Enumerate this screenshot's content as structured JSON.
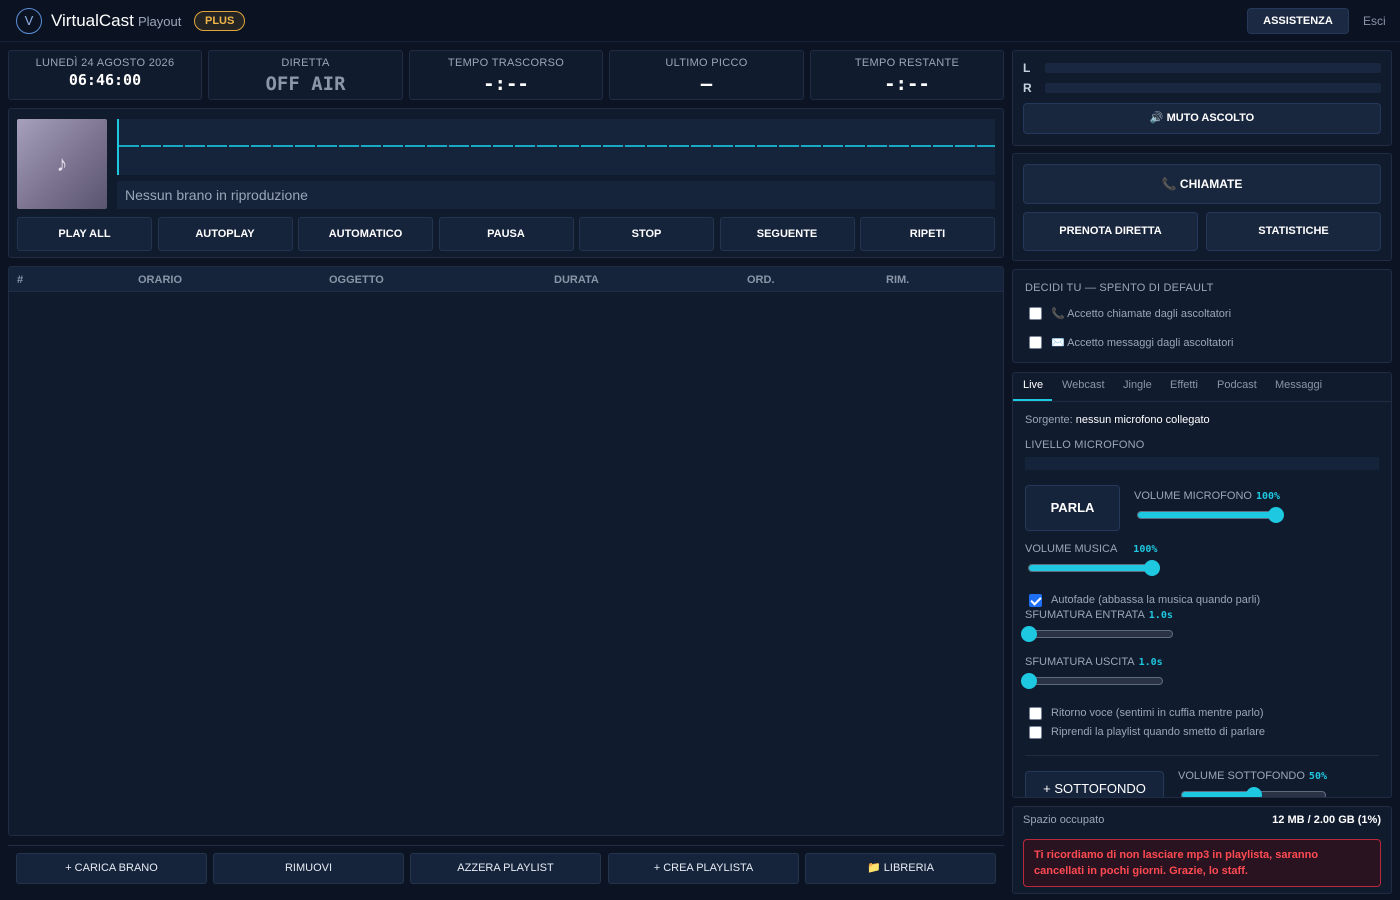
{
  "header": {
    "logo_letter": "V",
    "app_name": "VirtualCast",
    "section": "Playout",
    "plan_badge": "PLUS",
    "support_label": "ASSISTENZA",
    "logout_label": "Esci"
  },
  "stats": {
    "date": {
      "label": "LUNEDÌ 24 AGOSTO 2026",
      "value": "06:46:00"
    },
    "live": {
      "label": "DIRETTA",
      "value": "OFF AIR"
    },
    "elapsed": {
      "label": "TEMPO TRASCORSO",
      "value": "-:--"
    },
    "peak": {
      "label": "ULTIMO PICCO",
      "value": "—"
    },
    "remaining": {
      "label": "TEMPO RESTANTE",
      "value": "-:--"
    }
  },
  "player": {
    "cover_icon": "music-note-icon",
    "track_title": "Nessun brano in riproduzione",
    "buttons": [
      "PLAY ALL",
      "AUTOPLAY",
      "AUTOMATICO",
      "PAUSA",
      "STOP",
      "SEGUENTE",
      "RIPETI"
    ]
  },
  "playlist": {
    "columns": [
      "#",
      "ORARIO",
      "OGGETTO",
      "DURATA",
      "ORD.",
      "RIM."
    ],
    "rows": []
  },
  "actions": [
    "+ CARICA BRANO",
    "RIMUOVI",
    "AZZERA PLAYLIST",
    "+ CREA PLAYLISTA",
    "📁 LIBRERIA"
  ],
  "meters": {
    "left_label": "L",
    "right_label": "R",
    "mute_label": "🔊 MUTO ASCOLTO"
  },
  "calls": {
    "calls_label": "📞 CHIAMATE",
    "book_label": "PRENOTA DIRETTA",
    "stats_label": "STATISTICHE"
  },
  "listeners": {
    "title": "DECIDI TU — SPENTO DI DEFAULT",
    "accept_calls": "📞 Accetto chiamate dagli ascoltatori",
    "accept_messages": "✉️ Accetto messaggi dagli ascoltatori",
    "accept_calls_checked": false,
    "accept_messages_checked": false
  },
  "live": {
    "tabs": [
      "Live",
      "Webcast",
      "Jingle",
      "Effetti",
      "Podcast",
      "Messaggi"
    ],
    "active_tab": "Live",
    "source_label": "Sorgente:",
    "source_value": "nessun microfono collegato",
    "mic_level_label": "LIVELLO MICROFONO",
    "talk_label": "PARLA",
    "mic_volume_label": "VOLUME MICROFONO",
    "mic_volume_value": "100%",
    "mic_volume": 1.0,
    "music_volume_label": "VOLUME MUSICA",
    "music_volume_value": "100%",
    "music_volume": 1.0,
    "autofade_label": "Autofade (abbassa la musica quando parli)",
    "autofade_checked": true,
    "fade_in_label": "SFUMATURA ENTRATA",
    "fade_in_value": "1.0s",
    "fade_in": 0.0,
    "fade_out_label": "SFUMATURA USCITA",
    "fade_out_value": "1.0s",
    "fade_out": 0.0,
    "monitor_label": "Ritorno voce (sentimi in cuffia mentre parlo)",
    "monitor_checked": false,
    "resume_label": "Riprendi la playlist quando smetto di parlare",
    "resume_checked": false,
    "bg_button_label": "+ SOTTOFONDO",
    "bg_volume_label": "VOLUME SOTTOFONDO",
    "bg_volume_value": "50%",
    "bg_volume": 0.5
  },
  "storage": {
    "label": "Spazio occupato",
    "value": "12 MB / 2.00 GB (1%)",
    "warning": "Ti ricordiamo di non lasciare mp3 in playlista, saranno cancellati in pochi giorni. Grazie, lo staff."
  },
  "colors": {
    "accent": "#1ec8e0",
    "plus_badge": "#f0b549",
    "warning": "#ff4a52",
    "background": "#0c1424",
    "panel": "#111b2e"
  }
}
